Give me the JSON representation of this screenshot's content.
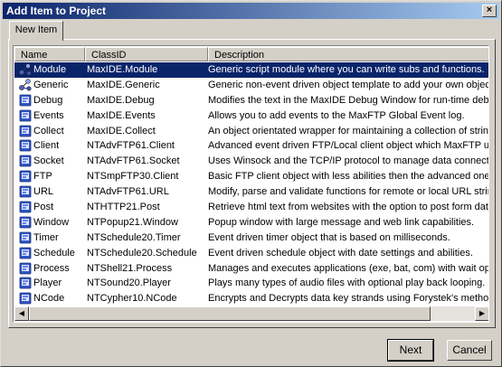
{
  "window": {
    "title": "Add Item to Project",
    "close_glyph": "×"
  },
  "tabs": [
    {
      "label": "New Item"
    }
  ],
  "columns": [
    "Name",
    "ClassID",
    "Description"
  ],
  "rows": [
    {
      "name": "Module",
      "class_id": "MaxIDE.Module",
      "description": "Generic script module where you can write subs and functions.",
      "icon": "module-icon",
      "selected": true
    },
    {
      "name": "Generic",
      "class_id": "MaxIDE.Generic",
      "description": "Generic non-event driven object template to add your own objects",
      "icon": "generic-icon"
    },
    {
      "name": "Debug",
      "class_id": "MaxIDE.Debug",
      "description": "Modifies the text in the MaxIDE Debug Window for run-time debug",
      "icon": "object-icon"
    },
    {
      "name": "Events",
      "class_id": "MaxIDE.Events",
      "description": "Allows you to add events to the MaxFTP Global Event log.",
      "icon": "object-icon"
    },
    {
      "name": "Collect",
      "class_id": "MaxIDE.Collect",
      "description": "An object orientated wrapper for maintaining a collection of strings",
      "icon": "object-icon"
    },
    {
      "name": "Client",
      "class_id": "NTAdvFTP61.Client",
      "description": "Advanced event driven FTP/Local client object which MaxFTP u",
      "icon": "object-icon"
    },
    {
      "name": "Socket",
      "class_id": "NTAdvFTP61.Socket",
      "description": "Uses Winsock and the TCP/IP protocol to manage data connecti",
      "icon": "object-icon"
    },
    {
      "name": "FTP",
      "class_id": "NTSmpFTP30.Client",
      "description": "Basic FTP client object with less abilities then the advanced one.",
      "icon": "object-icon"
    },
    {
      "name": "URL",
      "class_id": "NTAdvFTP61.URL",
      "description": "Modify, parse and validate functions for remote or local URL string",
      "icon": "object-icon"
    },
    {
      "name": "Post",
      "class_id": "NTHTTP21.Post",
      "description": "Retrieve html text from websites with the option to post form data.",
      "icon": "object-icon"
    },
    {
      "name": "Window",
      "class_id": "NTPopup21.Window",
      "description": "Popup window with large message and web link capabilities.",
      "icon": "object-icon"
    },
    {
      "name": "Timer",
      "class_id": "NTSchedule20.Timer",
      "description": "Event driven timer object that is based on milliseconds.",
      "icon": "object-icon"
    },
    {
      "name": "Schedule",
      "class_id": "NTSchedule20.Schedule",
      "description": "Event driven schedule object with date settings and abilities.",
      "icon": "object-icon"
    },
    {
      "name": "Process",
      "class_id": "NTShell21.Process",
      "description": "Manages and executes applications (exe, bat, com) with wait optio",
      "icon": "object-icon"
    },
    {
      "name": "Player",
      "class_id": "NTSound20.Player",
      "description": "Plays many types of audio files with optional play back looping.",
      "icon": "object-icon"
    },
    {
      "name": "NCode",
      "class_id": "NTCypher10.NCode",
      "description": "Encrypts and Decrypts data key strands using Forystek's method.",
      "icon": "object-icon"
    }
  ],
  "buttons": {
    "next": "Next",
    "cancel": "Cancel"
  },
  "scroll_icons": {
    "left": "◀",
    "right": "▶"
  },
  "colors": {
    "selection": "#0a246a",
    "title_start": "#0a246a",
    "title_end": "#a6caf0",
    "face": "#d4d0c8"
  }
}
